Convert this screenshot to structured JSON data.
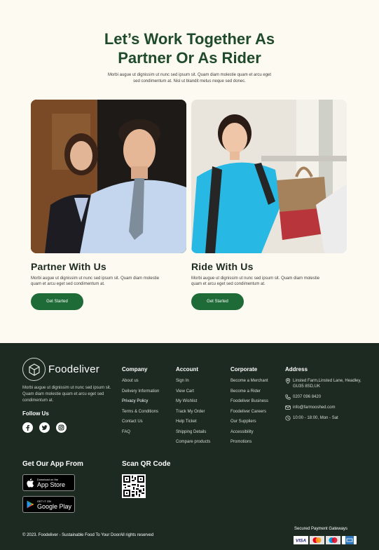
{
  "hero": {
    "title_line1": "Let’s Work Together As",
    "title_line2": "Partner Or As Rider",
    "subtitle": "Morbi augue ut dignissim ut nunc sed ipsum sit. Quam diam molestie quam et arcu eget sed condimentum at. Nisl ut blandit metus neque sed donec."
  },
  "cards": [
    {
      "title": "Partner With Us",
      "text": "Morbi augue ut dignissim ut nunc sed ipsum sit. Quam diam molestie quam et arcu eget sed condimentum at.",
      "button": "Get Started"
    },
    {
      "title": "Ride With Us",
      "text": "Morbi augue ut dignissim ut nunc sed ipsum sit. Quam diam molestie quam et arcu eget sed condimentum at.",
      "button": "Get Started"
    }
  ],
  "footer": {
    "brand": "Foodeliver",
    "about": "Morbi augue ut dignissim ut nunc sed ipsum sit. Quam diam molestie quam et arcu eget sed condimentum at.",
    "follow_us": "Follow Us",
    "socials": [
      "facebook-icon",
      "twitter-icon",
      "instagram-icon"
    ],
    "columns": {
      "company": {
        "heading": "Company",
        "items": [
          "About us",
          "Delivery Information",
          "Privacy Policy",
          "Terms & Conditions",
          "Contact Us",
          "FAQ"
        ]
      },
      "account": {
        "heading": "Account",
        "items": [
          "Sign In",
          "View Cart",
          "My Wishlist",
          "Track My Order",
          "Help Ticket",
          "Shipping Details",
          "Compare products"
        ]
      },
      "corporate": {
        "heading": "Corporate",
        "items": [
          "Become a Merchant",
          "Become a Rider",
          "Foodeliver Business",
          "Foodeliver Careers",
          "Our Suppliers",
          "Accessibility",
          "Promotions"
        ]
      },
      "address": {
        "heading": "Address",
        "location": "Linsted Farm,Linsted Lane, Headley, GU35 8SD,UK",
        "phone": "0207 096 8420",
        "email": "info@farmooshed.com",
        "hours": "10:00 - 18:00, Mon - Sat"
      }
    },
    "get_app": "Get Our App From",
    "app_store": {
      "small": "Download on the",
      "big": "App Store"
    },
    "google_play": {
      "small": "GET IT ON",
      "big": "Google Play"
    },
    "scan_qr": "Scan QR Code",
    "copyright": "© 2023. Foodeliver - Sustainable Food To Your DoorAll rights reserved",
    "payment_heading": "Secured Payment Gateways",
    "payment_methods": [
      "VISA",
      "Mastercard",
      "Maestro",
      "American Express"
    ]
  },
  "colors": {
    "brand_green": "#1f6b37",
    "title_green": "#1f4a2b",
    "footer_bg": "#1c2a21",
    "page_bg": "#fdfbf1"
  }
}
